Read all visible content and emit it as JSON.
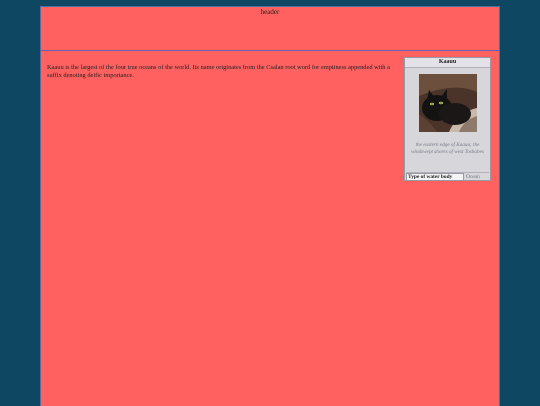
{
  "header": {
    "title": "header"
  },
  "article": {
    "body": "Kaauu is the largest of the four true oceans of the world. Its name originates from the Csalan root word for emptiness appended with a suffix denoting deific importance."
  },
  "infobox": {
    "title": "Kaauu",
    "image_icon": "black-cat-image",
    "caption": "the eastern edge of Kaauu; the windswept shores of west Toshabes",
    "rows": [
      {
        "label": "Type of water body",
        "value": "Ocean"
      }
    ]
  }
}
